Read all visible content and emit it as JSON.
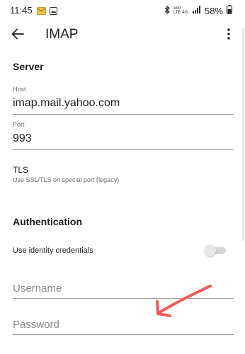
{
  "status_bar": {
    "time": "11:45",
    "network_label": "Vo0 LTE 4G",
    "battery": "58%"
  },
  "app_bar": {
    "title": "IMAP"
  },
  "server": {
    "header": "Server",
    "host_label": "Host",
    "host_value": "imap.mail.yahoo.com",
    "port_label": "Port",
    "port_value": "993",
    "tls_title": "TLS",
    "tls_subtitle": "Use SSL/TLS on special port (legacy)"
  },
  "authentication": {
    "header": "Authentication",
    "identity_label": "Use identity credentials",
    "identity_enabled": false,
    "username_placeholder": "Username",
    "password_placeholder": "Password"
  },
  "colors": {
    "annotation": "#f05a5a",
    "text_primary": "#1f1f1f",
    "text_secondary": "#6b6b6b"
  },
  "icons": [
    "back-arrow-icon",
    "more-vert-icon",
    "bluetooth-icon",
    "signal-icon",
    "mail-icon",
    "image-icon"
  ]
}
